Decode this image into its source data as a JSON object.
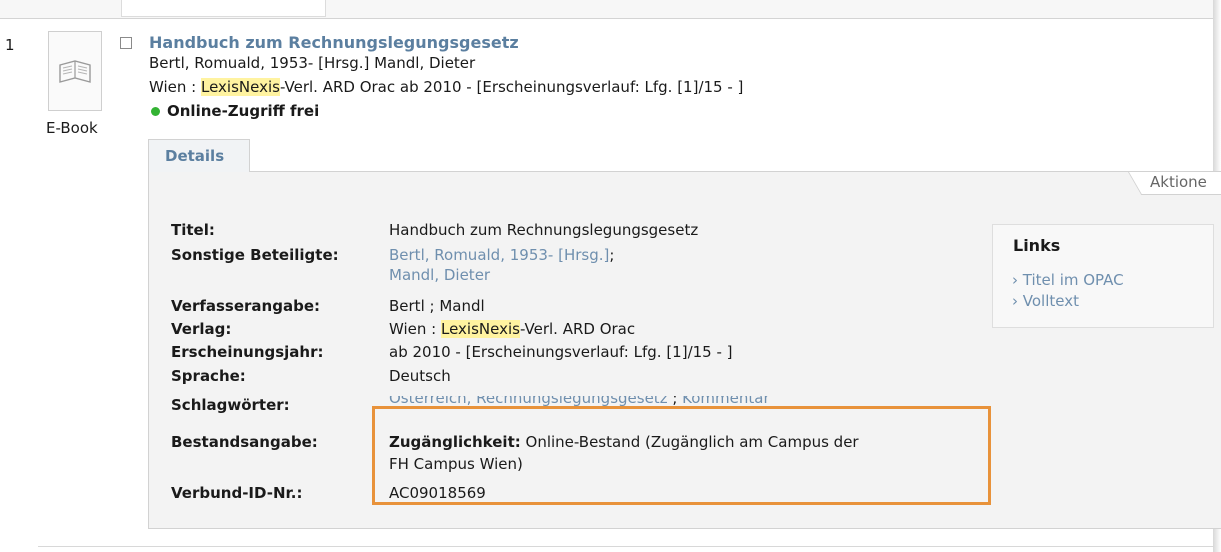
{
  "record": {
    "number": "1",
    "media_type": "E-Book",
    "title": "Handbuch zum Rechnungslegungsgesetz",
    "authors_line": "Bertl, Romuald, 1953- [Hrsg.] Mandl, Dieter",
    "pub_prefix": "Wien : ",
    "pub_highlight": "LexisNexis",
    "pub_suffix": "-Verl. ARD Orac ab 2010 - [Erscheinungsverlauf: Lfg. [1]/15 - ]",
    "availability": "Online-Zugriff frei",
    "availability_color": "#33b333"
  },
  "tabs": {
    "details": "Details",
    "actions": "Aktione"
  },
  "details": {
    "titel_label": "Titel:",
    "titel_value": "Handbuch zum Rechnungslegungsgesetz",
    "beteiligte_label": "Sonstige Beteiligte:",
    "beteiligte_1": "Bertl, Romuald, 1953- [Hrsg.]",
    "beteiligte_sep": ";",
    "beteiligte_2": "Mandl, Dieter",
    "verfasser_label": "Verfasserangabe:",
    "verfasser_value": "Bertl ; Mandl",
    "verlag_label": "Verlag:",
    "verlag_prefix": "Wien : ",
    "verlag_highlight": "LexisNexis",
    "verlag_suffix": "-Verl. ARD Orac",
    "jahr_label": "Erscheinungsjahr:",
    "jahr_value": "ab 2010 - [Erscheinungsverlauf: Lfg. [1]/15 - ]",
    "sprache_label": "Sprache:",
    "sprache_value": "Deutsch",
    "schlag_label": "Schlagwörter:",
    "schlag_link": "Österreich, Rechnungslegungsgesetz",
    "schlag_sep": " ; ",
    "schlag_link2": "Kommentar",
    "bestand_label": "Bestandsangabe:",
    "bestand_key": "Zugänglichkeit:",
    "bestand_value_1": " Online-Bestand (Zugänglich am Campus der",
    "bestand_value_2": "FH Campus Wien)",
    "verbund_label": "Verbund-ID-Nr.:",
    "verbund_value": "AC09018569"
  },
  "links": {
    "title": "Links",
    "items": [
      "Titel im OPAC",
      "Volltext"
    ]
  },
  "colors": {
    "link": "#6f8fae",
    "title_link": "#5b7fa0",
    "highlight": "#fff3a0",
    "annotation": "#e8923a"
  }
}
